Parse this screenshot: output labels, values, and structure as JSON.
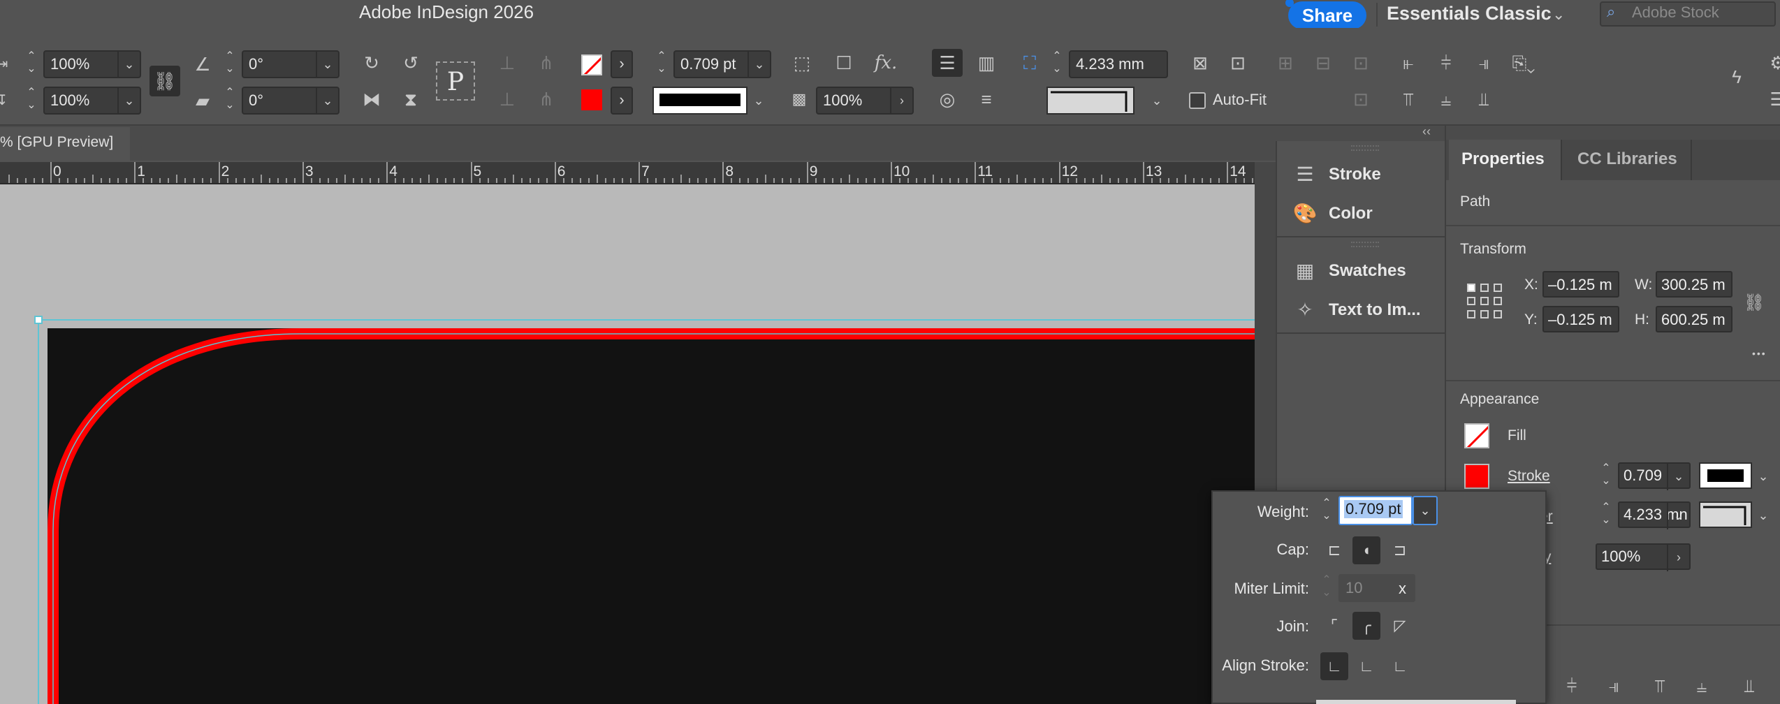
{
  "app": {
    "title": "Adobe InDesign 2026",
    "share_label": "Share",
    "workspace": "Essentials Classic",
    "stock_placeholder": "Adobe Stock"
  },
  "control_panel": {
    "scale_x": "100%",
    "scale_y": "100%",
    "rotation": "0°",
    "shear": "0°",
    "stroke_weight": "0.709 pt",
    "opacity": "100%",
    "gap_value": "4.233 mm",
    "autofit_label": "Auto-Fit",
    "autofit_checked": false,
    "text_frame_glyph": "P",
    "fx_glyph": "fx."
  },
  "document": {
    "tab_label": "% [GPU Preview]",
    "ruler_numbers": [
      "0",
      "1",
      "2",
      "3",
      "4",
      "5",
      "6",
      "7",
      "8",
      "9",
      "10",
      "11",
      "12",
      "13",
      "14"
    ],
    "colors": {
      "stroke": "#ff0000",
      "fill": "#121212",
      "pasteboard": "#b9b9b9",
      "selection": "#5ec4d4"
    }
  },
  "panel_strip": {
    "collapse_glyph": "‹‹",
    "items": [
      {
        "label": "Stroke",
        "icon": "stroke-lines-icon"
      },
      {
        "label": "Color",
        "icon": "palette-icon"
      },
      {
        "label": "Swatches",
        "icon": "swatches-grid-icon"
      },
      {
        "label": "Text to Im...",
        "icon": "text-to-image-icon"
      }
    ]
  },
  "properties": {
    "tabs": [
      "Properties",
      "CC Libraries"
    ],
    "object_type": "Path",
    "transform": {
      "title": "Transform",
      "x_label": "X:",
      "x_value": "–0.125 m",
      "y_label": "Y:",
      "y_value": "–0.125 m",
      "w_label": "W:",
      "w_value": "300.25 m",
      "h_label": "H:",
      "h_value": "600.25 m",
      "more_glyph": "•••"
    },
    "appearance": {
      "title": "Appearance",
      "fill_label": "Fill",
      "stroke_label": "Stroke",
      "stroke_weight": "0.709",
      "corner_partial_label": "er",
      "corner_value": "4.233 mn",
      "opacity_partial_label": "ty",
      "opacity_value": "100%"
    }
  },
  "stroke_popup": {
    "weight_label": "Weight:",
    "weight_value": "0.709 pt",
    "cap_label": "Cap:",
    "miter_label": "Miter Limit:",
    "miter_value": "10",
    "miter_unit": "x",
    "join_label": "Join:",
    "align_label": "Align Stroke:"
  }
}
